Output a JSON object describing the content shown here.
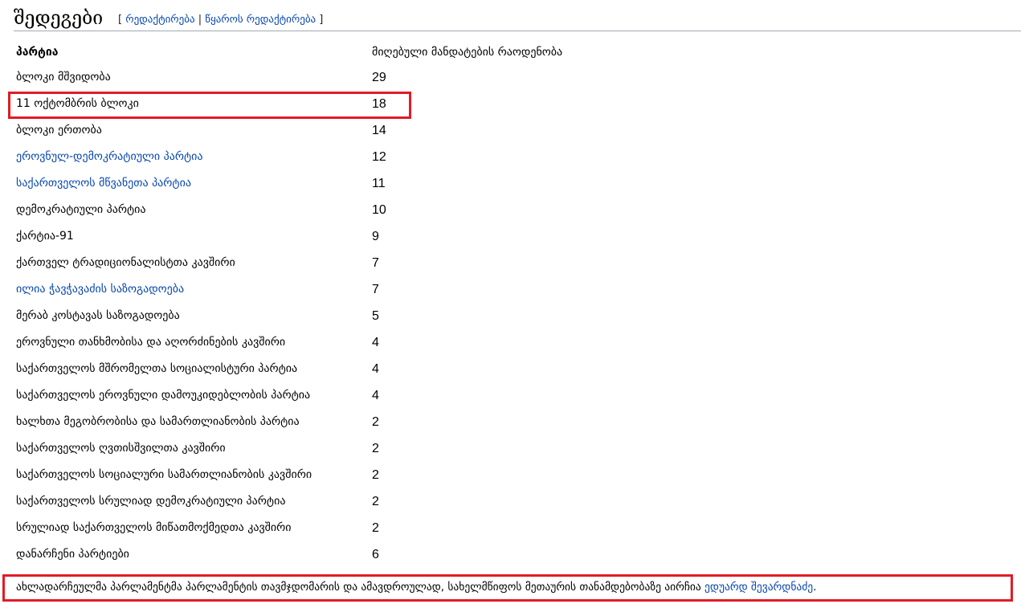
{
  "heading": {
    "title": "შედეგები",
    "edit": "რედაქტირება",
    "edit_source": "წყაროს რედაქტირება"
  },
  "table": {
    "headers": [
      "პარტია",
      "მიღებული მანდატების რაოდენობა"
    ],
    "rows": [
      {
        "party": "ბლოკი მშვიდობა",
        "seats": "29",
        "link": false
      },
      {
        "party": "11 ოქტომბრის ბლოკი",
        "seats": "18",
        "link": false,
        "highlight": true
      },
      {
        "party": "ბლოკი ერთობა",
        "seats": "14",
        "link": false
      },
      {
        "party": "ეროვნულ-დემოკრატიული პარტია",
        "seats": "12",
        "link": true
      },
      {
        "party": "საქართველოს მწვანეთა პარტია",
        "seats": "11",
        "link": true
      },
      {
        "party": "დემოკრატიული პარტია",
        "seats": "10",
        "link": false
      },
      {
        "party": "ქარტია-91",
        "seats": "9",
        "link": false
      },
      {
        "party": "ქართველ ტრადიციონალისტთა კავშირი",
        "seats": "7",
        "link": false
      },
      {
        "party": "ილია ჭავჭავაძის საზოგადოება",
        "seats": "7",
        "link": true
      },
      {
        "party": "მერაბ კოსტავას საზოგადოება",
        "seats": "5",
        "link": false
      },
      {
        "party": "ეროვნული თანხმობისა და აღორძინების კავშირი",
        "seats": "4",
        "link": false
      },
      {
        "party": "საქართველოს მშრომელთა სოციალისტური პარტია",
        "seats": "4",
        "link": false
      },
      {
        "party": "საქართველოს ეროვნული დამოუკიდებლობის პარტია",
        "seats": "4",
        "link": false
      },
      {
        "party": "ხალხთა მეგობრობისა და სამართლიანობის პარტია",
        "seats": "2",
        "link": false
      },
      {
        "party": "საქართველოს ღვთისშვილთა კავშირი",
        "seats": "2",
        "link": false
      },
      {
        "party": "საქართველოს სოციალური სამართლიანობის კავშირი",
        "seats": "2",
        "link": false
      },
      {
        "party": "საქართველოს სრულიად დემოკრატიული პარტია",
        "seats": "2",
        "link": false
      },
      {
        "party": "სრულიად საქართველოს მიწათმოქმედთა კავშირი",
        "seats": "2",
        "link": false
      },
      {
        "party": "დანარჩენი პარტიები",
        "seats": "6",
        "link": false
      }
    ]
  },
  "footer": {
    "text": "ახლადარჩეულმა პარლამენტმა პარლამენტის თავმჯდომარის და ამავდროულად, სახელმწიფოს მეთაურის თანამდებობაზე აირჩია ",
    "link": "ედუარდ შევარდნაძე",
    "end": "."
  },
  "colors": {
    "highlight": "#e21b25",
    "link": "#0645ad"
  }
}
